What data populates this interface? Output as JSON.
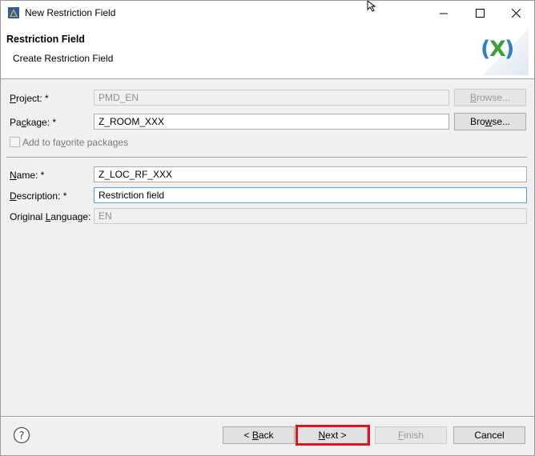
{
  "window": {
    "title": "New Restriction Field"
  },
  "banner": {
    "title": "Restriction Field",
    "subtitle": "Create Restriction Field",
    "icon_text": "(X)"
  },
  "form": {
    "project": {
      "label_pre": "",
      "label_key": "P",
      "label_post": "roject: *",
      "value": "PMD_EN",
      "browse_label_pre": "",
      "browse_label_key": "B",
      "browse_label_post": "rowse..."
    },
    "package": {
      "label_pre": "Pa",
      "label_key": "c",
      "label_post": "kage: *",
      "value": "Z_ROOM_XXX",
      "browse_label_pre": "Bro",
      "browse_label_key": "w",
      "browse_label_post": "se..."
    },
    "favorite": {
      "label_pre": "Add to fa",
      "label_key": "v",
      "label_post": "orite packages",
      "checked": false
    },
    "name": {
      "label_pre": "",
      "label_key": "N",
      "label_post": "ame: *",
      "value": "Z_LOC_RF_XXX"
    },
    "description": {
      "label_pre": "",
      "label_key": "D",
      "label_post": "escription: *",
      "value": "Restriction field"
    },
    "original_language": {
      "label_pre": "Original ",
      "label_key": "L",
      "label_post": "anguage:",
      "value": "EN"
    }
  },
  "footer": {
    "back_pre": "< ",
    "back_key": "B",
    "back_post": "ack",
    "next_pre": "",
    "next_key": "N",
    "next_post": "ext >",
    "finish_pre": "",
    "finish_key": "F",
    "finish_post": "inish",
    "cancel": "Cancel"
  },
  "colors": {
    "highlight": "#e0141a",
    "focus_border": "#569de5"
  }
}
